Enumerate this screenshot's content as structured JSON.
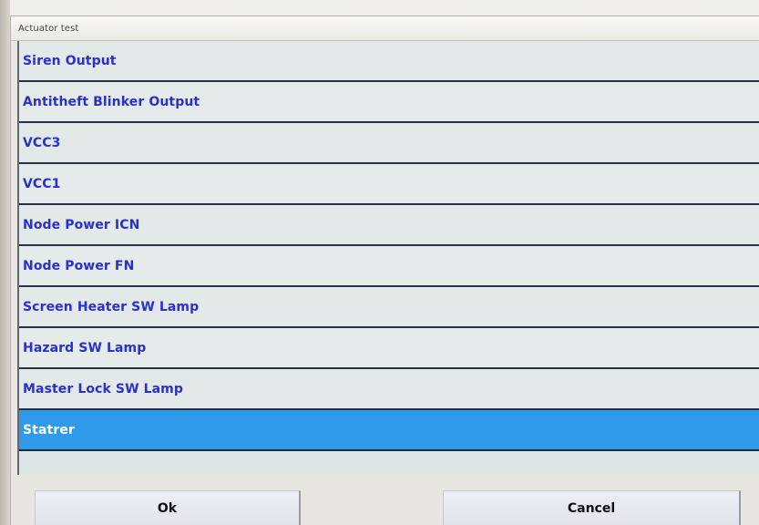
{
  "window": {
    "title": "Actuator test"
  },
  "list": {
    "items": [
      {
        "label": "Siren Output",
        "selected": false
      },
      {
        "label": "Antitheft Blinker Output",
        "selected": false
      },
      {
        "label": "VCC3",
        "selected": false
      },
      {
        "label": "VCC1",
        "selected": false
      },
      {
        "label": "Node Power ICN",
        "selected": false
      },
      {
        "label": "Node Power FN",
        "selected": false
      },
      {
        "label": "Screen Heater SW Lamp",
        "selected": false
      },
      {
        "label": "Hazard SW Lamp",
        "selected": false
      },
      {
        "label": "Master Lock SW Lamp",
        "selected": false
      },
      {
        "label": "Statrer",
        "selected": true
      }
    ]
  },
  "footer": {
    "ok_label": "Ok",
    "cancel_label": "Cancel"
  },
  "colors": {
    "selection": "#2f9aea",
    "item_text": "#2a2fcf",
    "separator": "#28304a"
  }
}
